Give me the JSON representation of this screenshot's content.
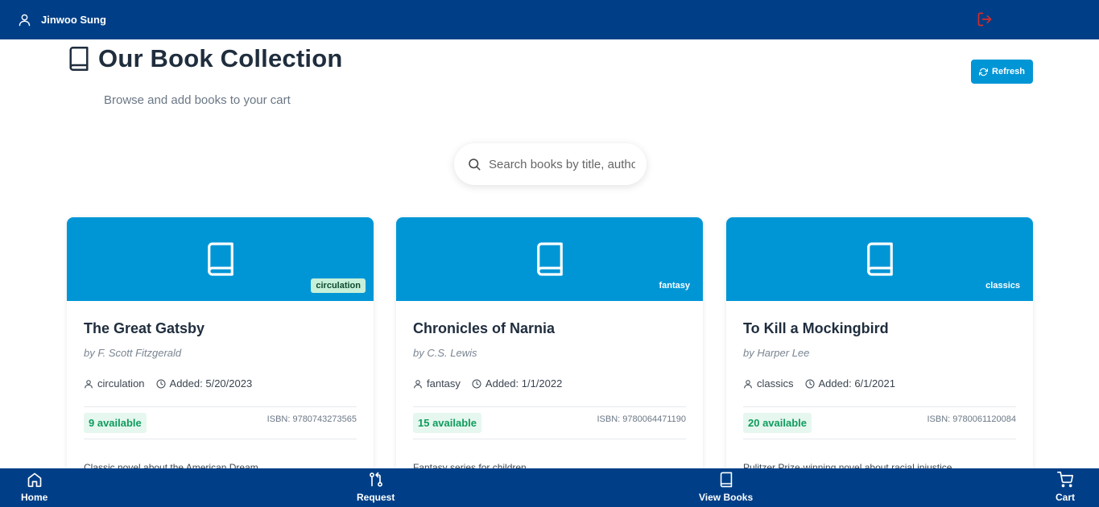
{
  "topbar": {
    "user_name": "Jinwoo Sung"
  },
  "header": {
    "title": "Our Book Collection",
    "subtitle": "Browse and add books to your cart",
    "refresh_label": "Refresh"
  },
  "search": {
    "placeholder": "Search books by title, author"
  },
  "books": [
    {
      "title": "The Great Gatsby",
      "author": "by F. Scott Fitzgerald",
      "tag": "circulation",
      "category": "circulation",
      "added": "Added: 5/20/2023",
      "available": "9 available",
      "isbn": "ISBN: 9780743273565",
      "description": "Classic novel about the American Dream"
    },
    {
      "title": "Chronicles of Narnia",
      "author": "by C.S. Lewis",
      "tag": "fantasy",
      "category": "fantasy",
      "added": "Added: 1/1/2022",
      "available": "15 available",
      "isbn": "ISBN: 9780064471190",
      "description": "Fantasy series for children"
    },
    {
      "title": "To Kill a Mockingbird",
      "author": "by Harper Lee",
      "tag": "classics",
      "category": "classics",
      "added": "Added: 6/1/2021",
      "available": "20 available",
      "isbn": "ISBN: 9780061120084",
      "description": "Pulitzer Prize-winning novel about racial injustice"
    }
  ],
  "bottom_nav": {
    "home": "Home",
    "request": "Request",
    "view_books": "View Books",
    "cart": "Cart"
  },
  "colors": {
    "nav_bg": "#003f87",
    "accent": "#0096d6",
    "available_text": "#0e9c5c",
    "logout_icon": "#d62b2b"
  }
}
